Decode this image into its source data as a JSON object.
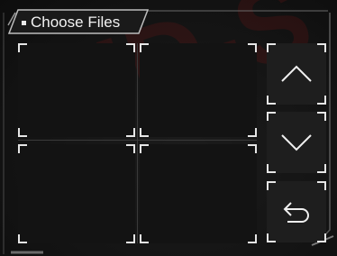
{
  "window": {
    "title": "Choose Files"
  },
  "watermark": {
    "text": "HD-S"
  },
  "file_grid": {
    "slots": [
      {
        "label": ""
      },
      {
        "label": ""
      },
      {
        "label": ""
      },
      {
        "label": ""
      }
    ]
  },
  "controls": {
    "up_icon": "chevron-up-icon",
    "down_icon": "chevron-down-icon",
    "back_icon": "return-arrow-icon"
  },
  "colors": {
    "background": "#121212",
    "accent": "#e6e6e6",
    "watermark": "#961414"
  }
}
